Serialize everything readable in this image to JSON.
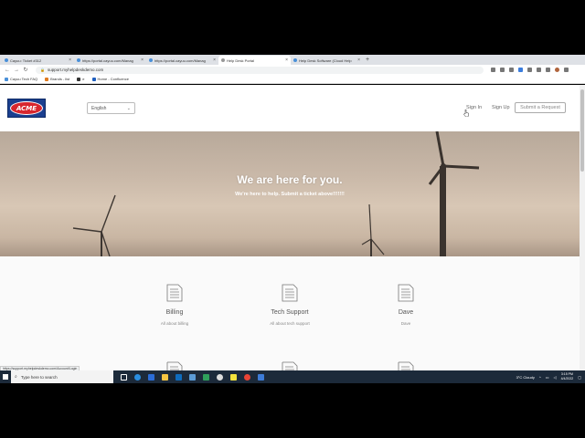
{
  "browser": {
    "tabs": [
      {
        "label": "Cayuu: Ticket #312",
        "active": false
      },
      {
        "label": "https://portal.cayuu.com/Manag",
        "active": false
      },
      {
        "label": "https://portal.cayuu.com/Manag",
        "active": false
      },
      {
        "label": "Help Desk Portal",
        "active": true
      },
      {
        "label": "Help Desk Software (Cloud Help",
        "active": false
      }
    ],
    "new_tab": "+",
    "url": "support.myhelpdeskdemo.com",
    "bookmarks": [
      {
        "label": "Cayuu Tech FAQ"
      },
      {
        "label": "Brands - list"
      },
      {
        "label": "e"
      },
      {
        "label": "Home - Confluence"
      }
    ]
  },
  "site": {
    "logo_text": "ACME",
    "language": "English",
    "nav": {
      "sign_in": "Sign In",
      "sign_up": "Sign Up",
      "submit_request": "Submit a Request"
    },
    "hero": {
      "title": "We are here for you.",
      "subtitle": "We're here to help. Submit a ticket above!!!!!!!"
    },
    "categories": [
      {
        "title": "Billing",
        "description": "All about billing"
      },
      {
        "title": "Tech Support",
        "description": "All about tech support"
      },
      {
        "title": "Dave",
        "description": "Dave"
      }
    ]
  },
  "status_url": "https://support.myhelpdeskdemo.com/Account/Login",
  "taskbar": {
    "search_placeholder": "Type here to search",
    "weather": "3°C  Cloudy",
    "time": "3:15 PM",
    "date": "4/4/2022"
  },
  "colors": {
    "logo_blue": "#1b3f8f",
    "logo_red": "#d7262e",
    "taskbar": "#1c2a3a"
  }
}
